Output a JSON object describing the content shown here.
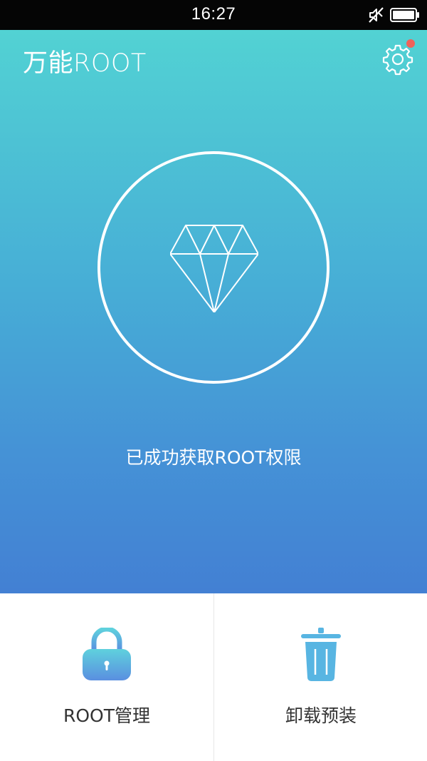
{
  "status_bar": {
    "time": "16:27",
    "icons": [
      "mute-icon",
      "battery-icon"
    ]
  },
  "header": {
    "title": "万能ROOT",
    "settings_icon": "gear-icon",
    "has_notification": true
  },
  "main": {
    "status_icon": "diamond-icon",
    "status_message": "已成功获取ROOT权限"
  },
  "actions": [
    {
      "label": "ROOT管理",
      "icon": "lock-icon"
    },
    {
      "label": "卸载预装",
      "icon": "trash-icon"
    }
  ],
  "colors": {
    "gradient_top": "#52d2d3",
    "gradient_bottom": "#4380d3",
    "notification_dot": "#f0625a",
    "label_text": "#333333",
    "lock_top": "#5fd1dd",
    "lock_bottom": "#5a8fe0",
    "trash": "#58b5e2"
  }
}
